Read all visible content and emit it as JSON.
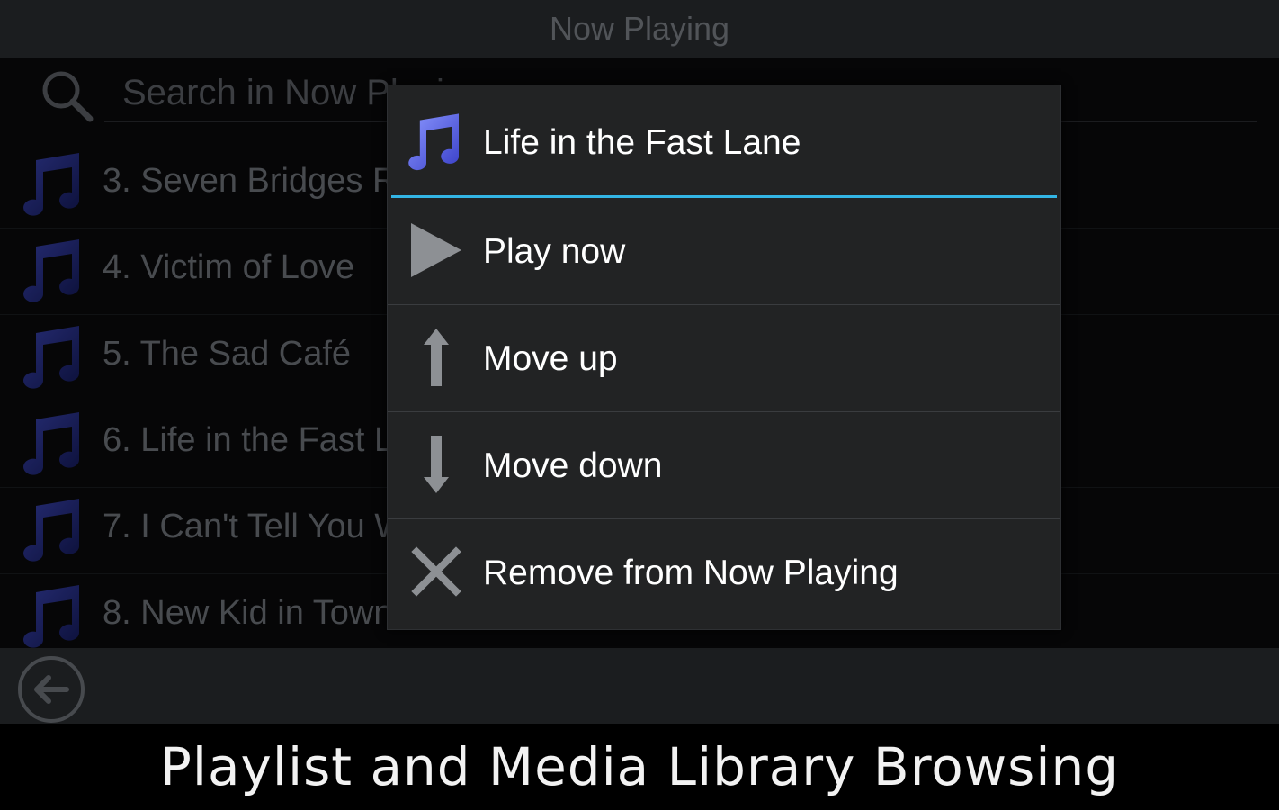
{
  "app": {
    "title": "Now Playing"
  },
  "search": {
    "placeholder": "Search in Now Playing"
  },
  "tracks": [
    {
      "label": "3. Seven Bridges Road"
    },
    {
      "label": "4. Victim of Love"
    },
    {
      "label": "5. The Sad Café"
    },
    {
      "label": "6. Life in the Fast Lane"
    },
    {
      "label": "7. I Can't Tell You Why"
    },
    {
      "label": "8. New Kid in Town"
    }
  ],
  "dialog": {
    "title": "Life in the Fast Lane",
    "items": [
      {
        "label": "Play now",
        "icon": "play-icon"
      },
      {
        "label": "Move up",
        "icon": "arrow-up-icon"
      },
      {
        "label": "Move down",
        "icon": "arrow-down-icon"
      },
      {
        "label": "Remove from Now Playing",
        "icon": "close-icon"
      }
    ]
  },
  "caption": "Playlist and Media Library Browsing",
  "colors": {
    "accent": "#33b5e5",
    "note_dark": "#2a2f8f",
    "note_bright": "#6a78ff",
    "dialog_bg": "#222324"
  }
}
